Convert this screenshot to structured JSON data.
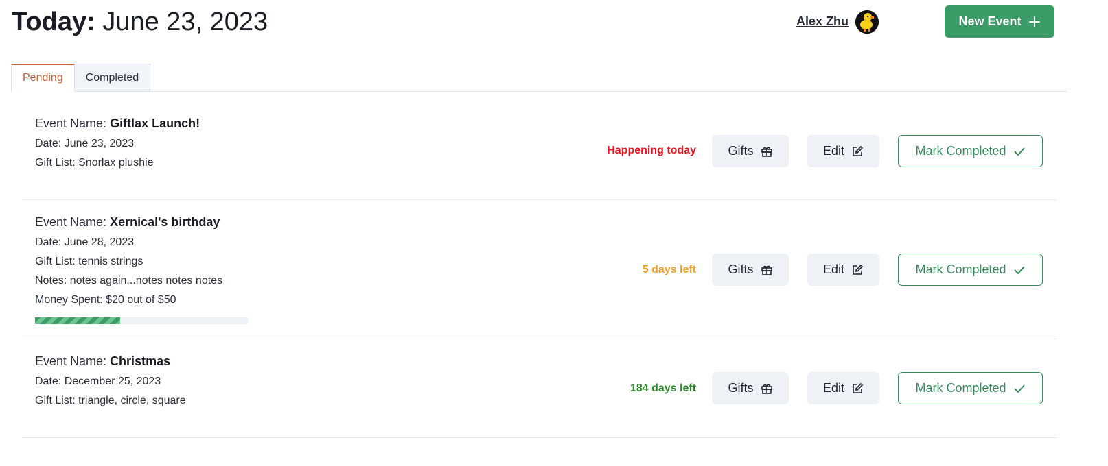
{
  "header": {
    "title_bold": "Today:",
    "title_date": "June 23, 2023",
    "user_name": "Alex Zhu",
    "new_event_label": "New Event"
  },
  "tabs": [
    {
      "label": "Pending",
      "active": true
    },
    {
      "label": "Completed",
      "active": false
    }
  ],
  "labels": {
    "event_name": "Event Name:",
    "gifts": "Gifts",
    "edit": "Edit",
    "mark_completed": "Mark Completed"
  },
  "events": [
    {
      "name": "Giftlax Launch!",
      "date": "Date: June 23, 2023",
      "gift_list": "Gift List: Snorlax plushie",
      "status": "Happening today",
      "status_color": "#e8141e"
    },
    {
      "name": "Xernical's birthday",
      "date": "Date: June 28, 2023",
      "gift_list": "Gift List: tennis strings",
      "notes": "Notes: notes again...notes notes notes",
      "money": "Money Spent: $20 out of $50",
      "money_fraction": 0.4,
      "status": "5 days left",
      "status_color": "#f2a12a"
    },
    {
      "name": "Christmas",
      "date": "Date: December 25, 2023",
      "gift_list": "Gift List: triangle, circle, square",
      "status": "184 days left",
      "status_color": "#2c8a2c"
    }
  ],
  "colors": {
    "accent_green": "#3a9c66",
    "tab_active": "#c8643a"
  },
  "icons": [
    "plus-icon",
    "gift-icon",
    "edit-icon",
    "check-icon",
    "avatar-duck"
  ]
}
